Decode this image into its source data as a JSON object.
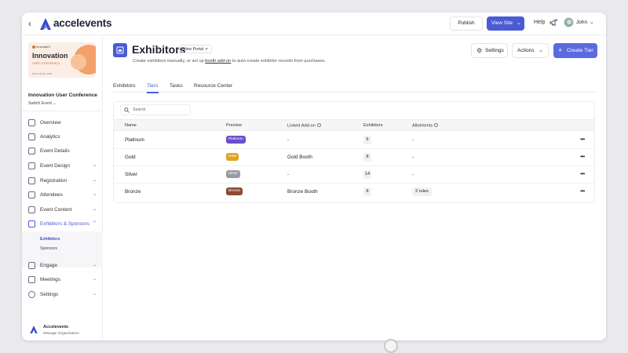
{
  "topbar": {
    "logo": "accelevents",
    "publish": "Publish",
    "view_site": "View Site",
    "help": "Help",
    "user": "John"
  },
  "sidebar": {
    "event_card": {
      "brand": "InnovateX",
      "big": "Innovation",
      "sub": "USER CONFERENCE",
      "foot": "Month 00-00, 2025"
    },
    "event_title": "Innovation User Conference",
    "switch_event": "Switch Event",
    "nav": [
      {
        "label": "Overview"
      },
      {
        "label": "Analytics"
      },
      {
        "label": "Event Details"
      },
      {
        "label": "Event Design"
      },
      {
        "label": "Registration"
      },
      {
        "label": "Attendees"
      },
      {
        "label": "Event Content"
      },
      {
        "label": "Exhibitors & Sponsors"
      },
      {
        "label": "Engage"
      },
      {
        "label": "Meetings"
      },
      {
        "label": "Settings"
      }
    ],
    "sub_nav": [
      {
        "label": "Exhibitors"
      },
      {
        "label": "Sponsors"
      }
    ],
    "org": {
      "name": "Accelevents",
      "sub": "Manage Organisation"
    }
  },
  "main": {
    "title": "Exhibitors",
    "view_portal": "View Portal",
    "desc_before": "Create exhibitors manually, or set up ",
    "desc_link": "booth add-on",
    "desc_after": " to auto-create exhibitor records from purchases.",
    "settings": "Settings",
    "actions": "Actions",
    "create_tier": "Create Tier",
    "tabs": [
      {
        "label": "Exhibitors"
      },
      {
        "label": "Tiers"
      },
      {
        "label": "Tasks"
      },
      {
        "label": "Resource Center"
      }
    ],
    "search_placeholder": "Search",
    "columns": [
      "Name",
      "Preview",
      "Linked Add-on",
      "Exhibitors",
      "Allotments"
    ],
    "rows": [
      {
        "name": "Platinum",
        "preview": "Platinum",
        "preview_color": "#6a4fc9",
        "addon": "-",
        "exhibitors": "6",
        "allotments": "-"
      },
      {
        "name": "Gold",
        "preview": "Gold",
        "preview_color": "#e0a41c",
        "addon": "Gold Booth",
        "exhibitors": "8",
        "allotments": "-"
      },
      {
        "name": "Silver",
        "preview": "Silver",
        "preview_color": "#9a9aa3",
        "addon": "-",
        "exhibitors": "14",
        "allotments": "-"
      },
      {
        "name": "Bronze",
        "preview": "Bronze",
        "preview_color": "#8c4a33",
        "addon": "Bronze Booth",
        "exhibitors": "8",
        "allotments": "2 rules"
      }
    ]
  },
  "colors": {
    "accent": "#4a5bd6",
    "active_nav": "#4a5bd6"
  }
}
